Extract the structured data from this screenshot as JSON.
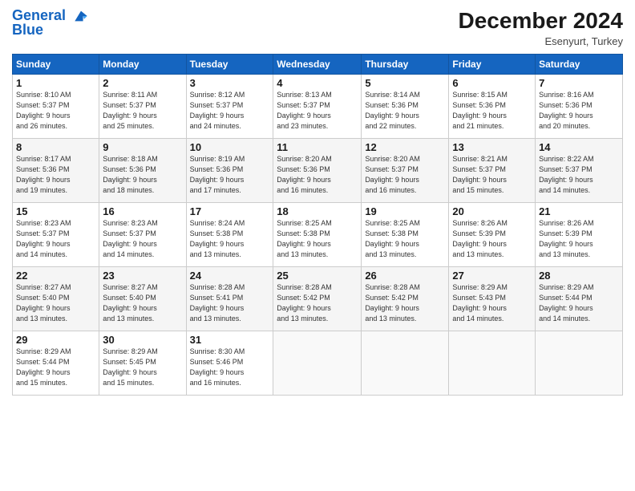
{
  "logo": {
    "line1": "General",
    "line2": "Blue"
  },
  "title": "December 2024",
  "subtitle": "Esenyurt, Turkey",
  "days_of_week": [
    "Sunday",
    "Monday",
    "Tuesday",
    "Wednesday",
    "Thursday",
    "Friday",
    "Saturday"
  ],
  "weeks": [
    [
      {
        "num": "1",
        "rise": "8:10 AM",
        "set": "5:37 PM",
        "daylight": "9 hours and 26 minutes."
      },
      {
        "num": "2",
        "rise": "8:11 AM",
        "set": "5:37 PM",
        "daylight": "9 hours and 25 minutes."
      },
      {
        "num": "3",
        "rise": "8:12 AM",
        "set": "5:37 PM",
        "daylight": "9 hours and 24 minutes."
      },
      {
        "num": "4",
        "rise": "8:13 AM",
        "set": "5:37 PM",
        "daylight": "9 hours and 23 minutes."
      },
      {
        "num": "5",
        "rise": "8:14 AM",
        "set": "5:36 PM",
        "daylight": "9 hours and 22 minutes."
      },
      {
        "num": "6",
        "rise": "8:15 AM",
        "set": "5:36 PM",
        "daylight": "9 hours and 21 minutes."
      },
      {
        "num": "7",
        "rise": "8:16 AM",
        "set": "5:36 PM",
        "daylight": "9 hours and 20 minutes."
      }
    ],
    [
      {
        "num": "8",
        "rise": "8:17 AM",
        "set": "5:36 PM",
        "daylight": "9 hours and 19 minutes."
      },
      {
        "num": "9",
        "rise": "8:18 AM",
        "set": "5:36 PM",
        "daylight": "9 hours and 18 minutes."
      },
      {
        "num": "10",
        "rise": "8:19 AM",
        "set": "5:36 PM",
        "daylight": "9 hours and 17 minutes."
      },
      {
        "num": "11",
        "rise": "8:20 AM",
        "set": "5:36 PM",
        "daylight": "9 hours and 16 minutes."
      },
      {
        "num": "12",
        "rise": "8:20 AM",
        "set": "5:37 PM",
        "daylight": "9 hours and 16 minutes."
      },
      {
        "num": "13",
        "rise": "8:21 AM",
        "set": "5:37 PM",
        "daylight": "9 hours and 15 minutes."
      },
      {
        "num": "14",
        "rise": "8:22 AM",
        "set": "5:37 PM",
        "daylight": "9 hours and 14 minutes."
      }
    ],
    [
      {
        "num": "15",
        "rise": "8:23 AM",
        "set": "5:37 PM",
        "daylight": "9 hours and 14 minutes."
      },
      {
        "num": "16",
        "rise": "8:23 AM",
        "set": "5:37 PM",
        "daylight": "9 hours and 14 minutes."
      },
      {
        "num": "17",
        "rise": "8:24 AM",
        "set": "5:38 PM",
        "daylight": "9 hours and 13 minutes."
      },
      {
        "num": "18",
        "rise": "8:25 AM",
        "set": "5:38 PM",
        "daylight": "9 hours and 13 minutes."
      },
      {
        "num": "19",
        "rise": "8:25 AM",
        "set": "5:38 PM",
        "daylight": "9 hours and 13 minutes."
      },
      {
        "num": "20",
        "rise": "8:26 AM",
        "set": "5:39 PM",
        "daylight": "9 hours and 13 minutes."
      },
      {
        "num": "21",
        "rise": "8:26 AM",
        "set": "5:39 PM",
        "daylight": "9 hours and 13 minutes."
      }
    ],
    [
      {
        "num": "22",
        "rise": "8:27 AM",
        "set": "5:40 PM",
        "daylight": "9 hours and 13 minutes."
      },
      {
        "num": "23",
        "rise": "8:27 AM",
        "set": "5:40 PM",
        "daylight": "9 hours and 13 minutes."
      },
      {
        "num": "24",
        "rise": "8:28 AM",
        "set": "5:41 PM",
        "daylight": "9 hours and 13 minutes."
      },
      {
        "num": "25",
        "rise": "8:28 AM",
        "set": "5:42 PM",
        "daylight": "9 hours and 13 minutes."
      },
      {
        "num": "26",
        "rise": "8:28 AM",
        "set": "5:42 PM",
        "daylight": "9 hours and 13 minutes."
      },
      {
        "num": "27",
        "rise": "8:29 AM",
        "set": "5:43 PM",
        "daylight": "9 hours and 14 minutes."
      },
      {
        "num": "28",
        "rise": "8:29 AM",
        "set": "5:44 PM",
        "daylight": "9 hours and 14 minutes."
      }
    ],
    [
      {
        "num": "29",
        "rise": "8:29 AM",
        "set": "5:44 PM",
        "daylight": "9 hours and 15 minutes."
      },
      {
        "num": "30",
        "rise": "8:29 AM",
        "set": "5:45 PM",
        "daylight": "9 hours and 15 minutes."
      },
      {
        "num": "31",
        "rise": "8:30 AM",
        "set": "5:46 PM",
        "daylight": "9 hours and 16 minutes."
      },
      null,
      null,
      null,
      null
    ]
  ],
  "labels": {
    "sunrise": "Sunrise:",
    "sunset": "Sunset:",
    "daylight": "Daylight hours"
  }
}
